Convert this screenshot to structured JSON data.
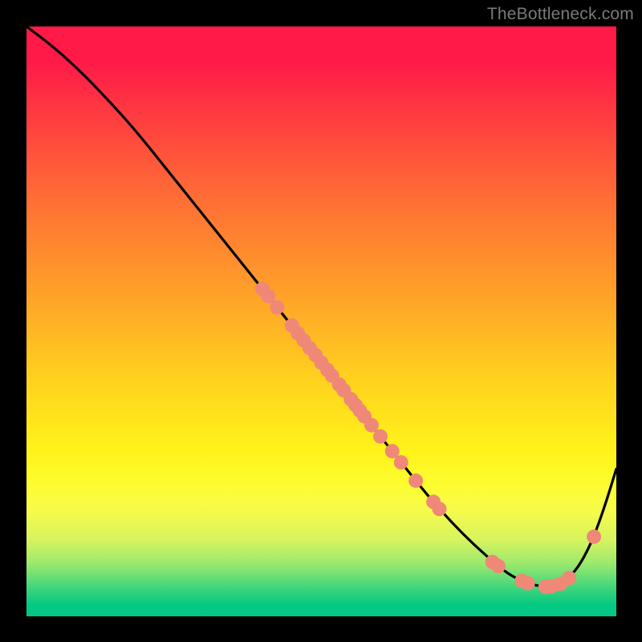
{
  "attribution": "TheBottleneck.com",
  "chart_data": {
    "type": "line",
    "title": "",
    "xlabel": "",
    "ylabel": "",
    "xlim": [
      0,
      100
    ],
    "ylim": [
      0,
      100
    ],
    "series": [
      {
        "name": "curve",
        "x": [
          0,
          4,
          8,
          12,
          18,
          24,
          30,
          36,
          42,
          48,
          52,
          56,
          60,
          64,
          68,
          72,
          76,
          80,
          82,
          84,
          86,
          88,
          90,
          92,
          94,
          96,
          98,
          100
        ],
        "y": [
          100,
          97,
          93.5,
          89.5,
          83,
          75.5,
          68,
          60.5,
          53,
          45.5,
          40.5,
          35.5,
          30.5,
          25.5,
          20.5,
          16,
          12,
          8.5,
          7,
          6,
          5.3,
          5,
          5.3,
          6.5,
          9,
          13,
          18.5,
          25
        ]
      }
    ],
    "markers": [
      {
        "x": 40.0,
        "y": 55.5
      },
      {
        "x": 41.0,
        "y": 54.3
      },
      {
        "x": 42.5,
        "y": 52.4
      },
      {
        "x": 45.0,
        "y": 49.3
      },
      {
        "x": 46.0,
        "y": 48.0
      },
      {
        "x": 47.0,
        "y": 46.8
      },
      {
        "x": 48.0,
        "y": 45.5
      },
      {
        "x": 49.0,
        "y": 44.3
      },
      {
        "x": 50.0,
        "y": 43.0
      },
      {
        "x": 51.0,
        "y": 41.8
      },
      {
        "x": 51.8,
        "y": 40.8
      },
      {
        "x": 53.0,
        "y": 39.3
      },
      {
        "x": 53.8,
        "y": 38.3
      },
      {
        "x": 55.0,
        "y": 36.8
      },
      {
        "x": 55.8,
        "y": 35.8
      },
      {
        "x": 56.5,
        "y": 34.9
      },
      {
        "x": 57.3,
        "y": 33.9
      },
      {
        "x": 58.5,
        "y": 32.4
      },
      {
        "x": 60.0,
        "y": 30.5
      },
      {
        "x": 62.0,
        "y": 28.0
      },
      {
        "x": 63.5,
        "y": 26.1
      },
      {
        "x": 66.0,
        "y": 23.0
      },
      {
        "x": 69.0,
        "y": 19.4
      },
      {
        "x": 70.0,
        "y": 18.2
      },
      {
        "x": 79.0,
        "y": 9.2
      },
      {
        "x": 80.0,
        "y": 8.5
      },
      {
        "x": 84.0,
        "y": 6.0
      },
      {
        "x": 85.0,
        "y": 5.6
      },
      {
        "x": 88.0,
        "y": 5.0
      },
      {
        "x": 89.0,
        "y": 5.1
      },
      {
        "x": 90.5,
        "y": 5.5
      },
      {
        "x": 92.0,
        "y": 6.5
      },
      {
        "x": 96.2,
        "y": 13.5
      }
    ],
    "marker_style": {
      "color": "#f08878",
      "radius_px": 9
    }
  }
}
